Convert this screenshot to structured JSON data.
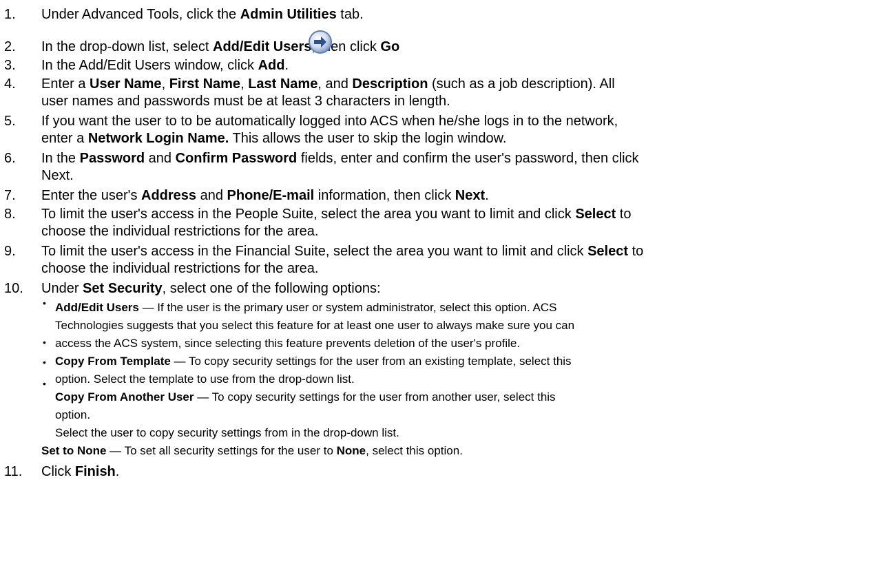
{
  "steps": [
    {
      "num": "1.",
      "parts": [
        "Under Advanced Tools, click the ",
        "Admin Utilities",
        " tab."
      ]
    },
    {
      "num": "2.",
      "parts": [
        "In the drop-down list, select ",
        "Add/Edit Users",
        ", then click ",
        "Go",
        "."
      ]
    },
    {
      "num": "3.",
      "parts": [
        "In the Add/Edit Users window, click ",
        "Add",
        "."
      ]
    },
    {
      "num": "4.",
      "lines": [
        [
          "Enter a ",
          "User Name",
          ", ",
          "First Name",
          ", ",
          "Last Name",
          ", and ",
          "Description",
          " (such as a job description). All"
        ],
        [
          "user names and passwords must be at least 3 characters in length."
        ]
      ]
    },
    {
      "num": "5.",
      "lines": [
        [
          "If you want the user to to be automatically logged into ACS when he/she logs in to the network,"
        ],
        [
          "enter a ",
          "Network Login Name.",
          " This allows the user to skip the login window."
        ]
      ]
    },
    {
      "num": "6.",
      "lines": [
        [
          "In the ",
          "Password",
          " and ",
          "Confirm Password",
          " fields, enter and confirm the user's password, then click"
        ],
        [
          "Next."
        ]
      ]
    },
    {
      "num": "7.",
      "parts": [
        "Enter the user's ",
        "Address",
        " and ",
        "Phone/E-mail",
        " information, then click ",
        "Next",
        "."
      ]
    },
    {
      "num": "8.",
      "lines": [
        [
          "To limit the user's access in the People Suite, select the area you want to limit and click ",
          "Select",
          " to"
        ],
        [
          "choose the individual restrictions for the area."
        ]
      ]
    },
    {
      "num": "9.",
      "lines": [
        [
          "To limit the user's access in the Financial Suite, select the area you want to limit and click ",
          "Select",
          " to"
        ],
        [
          "choose the individual restrictions for the area."
        ]
      ]
    },
    {
      "num": "10.",
      "parts": [
        "Under ",
        "Set Security",
        ", select one of the following options:"
      ]
    },
    {
      "num": "11.",
      "parts": [
        "Click ",
        "Finish",
        "."
      ]
    }
  ],
  "options": [
    [
      "Add/Edit Users",
      " — If the user is the primary user or system administrator, select this option. ACS"
    ],
    [
      "Technologies suggests that you select this feature for at least one user to always make sure you can"
    ],
    [
      "access the ACS system, since selecting this feature prevents deletion of the user's profile."
    ],
    [
      "Copy From Template",
      " — To copy security settings for the user from an existing template, select this"
    ],
    [
      "option. Select the template to use from the drop-down list."
    ],
    [
      "Copy From Another User",
      " — To copy security settings for the user from another user, select this"
    ],
    [
      "option."
    ],
    [
      "Select the user to copy security settings from in the drop-down list."
    ]
  ],
  "set_none": [
    "Set to None",
    " — To set all security settings for the user to ",
    "None",
    ", select this option."
  ],
  "bullet_glyph": "•",
  "icon": "go-arrow-icon"
}
